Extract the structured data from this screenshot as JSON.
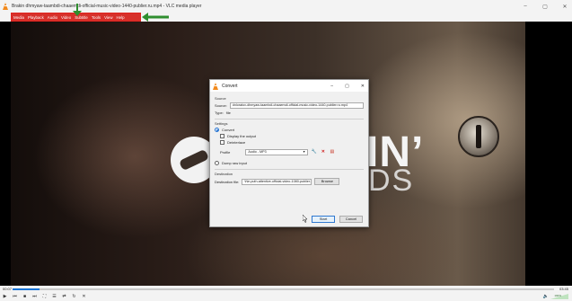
{
  "window": {
    "title": "Brakin dhmyaw-taambdi-chaaemdi-official-music-video-1440-publier.ru.mp4 - VLC media player",
    "controls": [
      "–",
      "▢",
      "✕"
    ]
  },
  "menu": {
    "items": [
      "Media",
      "Playback",
      "Audio",
      "Video",
      "Subtitle",
      "Tools",
      "View",
      "Help"
    ]
  },
  "video": {
    "logo_text_1": "IN’",
    "logo_text_2": "DS"
  },
  "dialog": {
    "title": "Convert",
    "controls": [
      "–",
      "▢",
      "✕"
    ],
    "source_section": "Source",
    "source_label": "Source:",
    "source_value": "dnloratov-dhmyaw-taambdi-chaaemdi-official-music-video-1440-publier.ru.mp4",
    "type_label": "Type:",
    "type_value": "file",
    "settings_section": "Settings",
    "convert_label": "Convert",
    "display_output_label": "Display the output",
    "deinterlace_label": "Deinterlace",
    "profile_label": "Profile",
    "profile_value": "Audio - MP3",
    "dump_raw_label": "Dump raw input",
    "destination_section": "Destination",
    "destination_label": "Destination file:",
    "destination_value": "\\Ne-puth-attentive-official-video-1080-publier.ru.mp4",
    "browse_label": "Browse",
    "start_label": "Start",
    "cancel_label": "Cancel"
  },
  "player": {
    "elapsed": "00:07",
    "total": "03:45",
    "progress": 0.05,
    "volume_label": "100%",
    "buttons": [
      "▶",
      "⏮",
      "■",
      "⏭",
      "⛶",
      "☰",
      "⇄",
      "↻",
      "✕"
    ]
  },
  "colors": {
    "highlight_red": "#d7312b",
    "arrow_green": "#2f8f2f",
    "accent_blue": "#1a74d6",
    "vlc_orange": "#f28a1d"
  }
}
